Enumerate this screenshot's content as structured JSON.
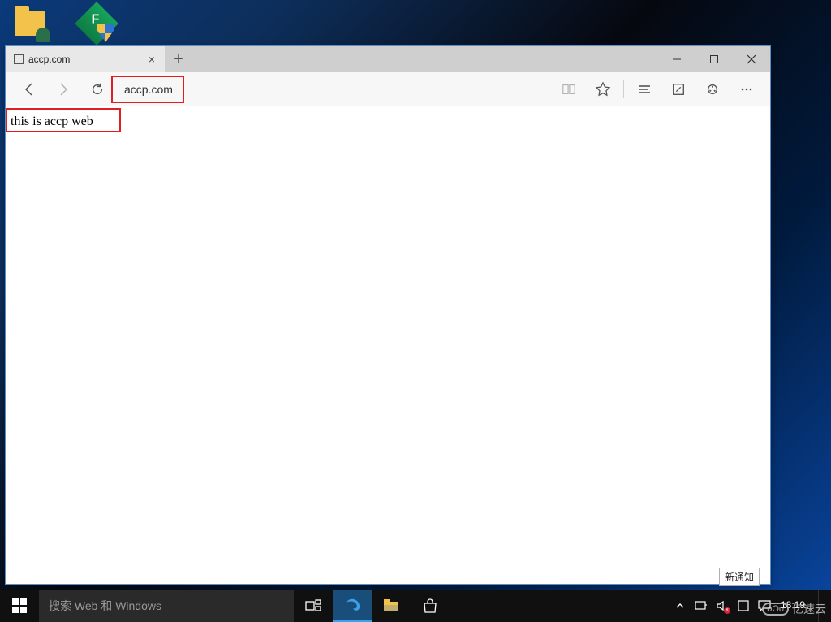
{
  "desktop_icons": {
    "folder": "folder-user",
    "diamond_letter": "F"
  },
  "browser": {
    "tab_title": "accp.com",
    "address": "accp.com",
    "page_text": "this is accp web"
  },
  "tooltip": "新通知",
  "taskbar": {
    "search_placeholder": "搜索 Web 和 Windows",
    "clock": "18:19"
  },
  "watermark": {
    "icon_text": "oOo",
    "text": "亿速云"
  }
}
